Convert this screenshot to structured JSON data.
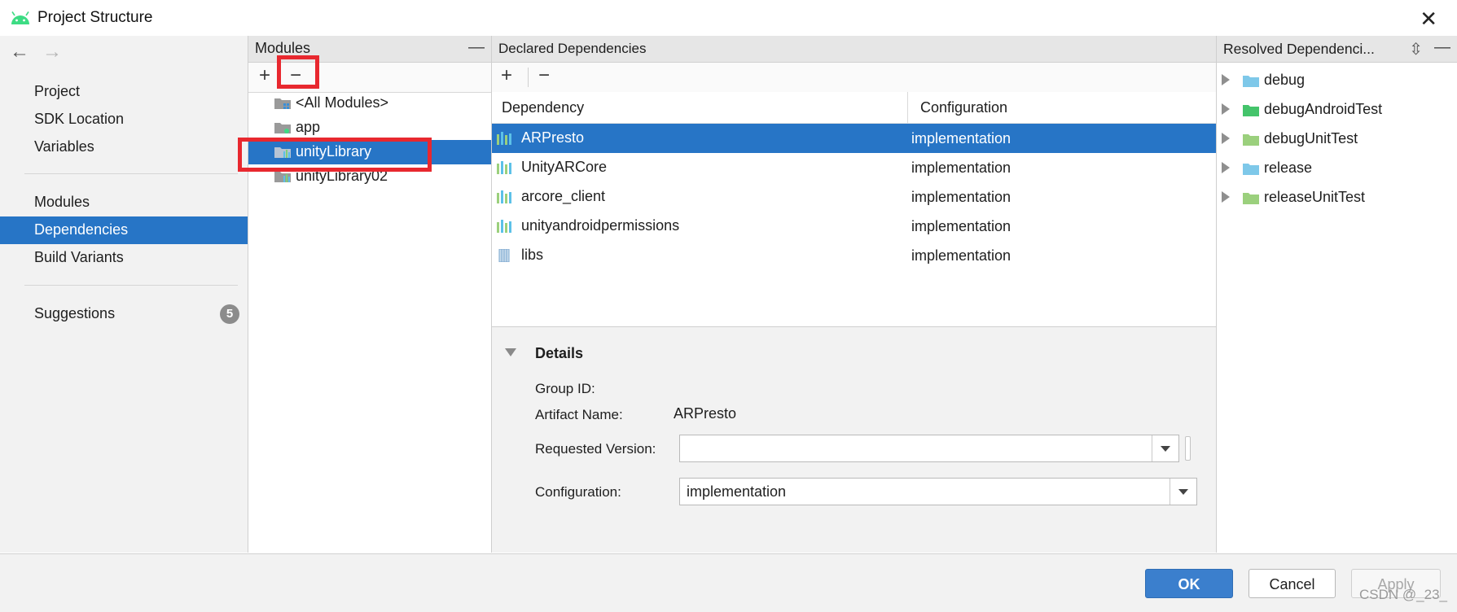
{
  "window": {
    "title": "Project Structure",
    "close_glyph": "✕"
  },
  "nav": {
    "back_glyph": "←",
    "forward_glyph": "→",
    "group1": [
      "Project",
      "SDK Location",
      "Variables"
    ],
    "group2": [
      "Modules",
      "Dependencies",
      "Build Variants"
    ],
    "selected": "Dependencies",
    "suggestions_label": "Suggestions",
    "suggestions_count": "5"
  },
  "modules": {
    "header": "Modules",
    "add_glyph": "+",
    "remove_glyph": "−",
    "minimize_glyph": "—",
    "items": [
      "<All Modules>",
      "app",
      "unityLibrary",
      "unityLibrary02"
    ],
    "selected": "unityLibrary"
  },
  "declared": {
    "header": "Declared Dependencies",
    "add_glyph": "+",
    "remove_glyph": "−",
    "columns": [
      "Dependency",
      "Configuration"
    ],
    "rows": [
      {
        "name": "ARPresto",
        "config": "implementation",
        "icon": "library-icon"
      },
      {
        "name": "UnityARCore",
        "config": "implementation",
        "icon": "library-icon"
      },
      {
        "name": "arcore_client",
        "config": "implementation",
        "icon": "library-icon"
      },
      {
        "name": "unityandroidpermissions",
        "config": "implementation",
        "icon": "library-icon"
      },
      {
        "name": "libs",
        "config": "implementation",
        "icon": "jar-icon"
      }
    ],
    "selected": "ARPresto"
  },
  "details": {
    "title": "Details",
    "group_id_label": "Group ID:",
    "group_id_value": "",
    "artifact_label": "Artifact Name:",
    "artifact_value": "ARPresto",
    "requested_version_label": "Requested Version:",
    "requested_version_value": "",
    "configuration_label": "Configuration:",
    "configuration_value": "implementation"
  },
  "resolved": {
    "header": "Resolved Dependenci...",
    "collapse_glyph": "⇳",
    "minimize_glyph": "—",
    "items": [
      {
        "label": "debug",
        "color": "#7ec8e9"
      },
      {
        "label": "debugAndroidTest",
        "color": "#44c46b"
      },
      {
        "label": "debugUnitTest",
        "color": "#9bd07d"
      },
      {
        "label": "release",
        "color": "#7ec8e9"
      },
      {
        "label": "releaseUnitTest",
        "color": "#9bd07d"
      }
    ]
  },
  "buttons": {
    "ok": "OK",
    "cancel": "Cancel",
    "apply": "Apply"
  },
  "watermark": "CSDN @_23_",
  "colors": {
    "selection": "#2775c6",
    "highlight_box": "#e8282f",
    "android_green": "#3ddc84"
  }
}
